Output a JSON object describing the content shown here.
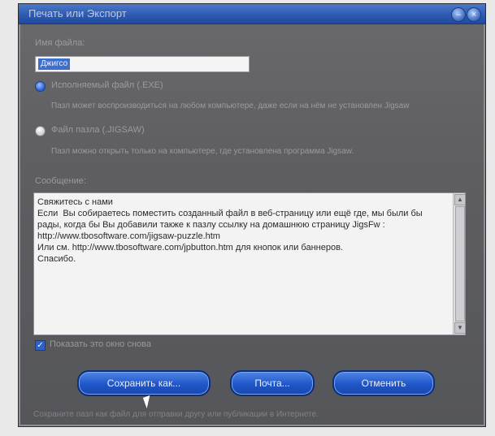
{
  "window": {
    "title": "Печать или Экспорт",
    "minimize_glyph": "–",
    "close_glyph": "×"
  },
  "form": {
    "filename_label": "Имя файла:",
    "filename_value": "Джигсо",
    "option1_label": "Исполняемый файл (.EXE)",
    "option1_desc": "Пазл может воспроизводиться на любом компьютере, даже если на нём не установлен Jigsaw",
    "option2_label": "Файл пазла (.JIGSAW)",
    "option2_desc": "Пазл можно открыть только на компьютере, где установлена программа Jigsaw.",
    "message_label": "Сообщение:",
    "message_text": "Свяжитесь с нами\nЕсли  Вы собираетесь поместить созданный файл в веб-страницу или ещё где, мы были бы рады, когда бы Вы добавили также к пазлу ссылку на домашнюю страницу JigsFw :\nhttp://www.tbosoftware.com/jigsaw-puzzle.htm\nИли см. http://www.tbosoftware.com/jpbutton.htm для кнопок или баннеров.\nСпасибо.",
    "checkbox_label": "Показать это окно снова"
  },
  "buttons": {
    "save_as": "Сохранить как...",
    "mail": "Почта...",
    "cancel": "Отменить"
  },
  "status_text": "Сохраните пазл как файл для отправки другу или публикации в Интернете.",
  "colors": {
    "dialog_bg": "#5e5e61",
    "titlebar": "#2e5bb3",
    "button": "#1f56c8"
  }
}
